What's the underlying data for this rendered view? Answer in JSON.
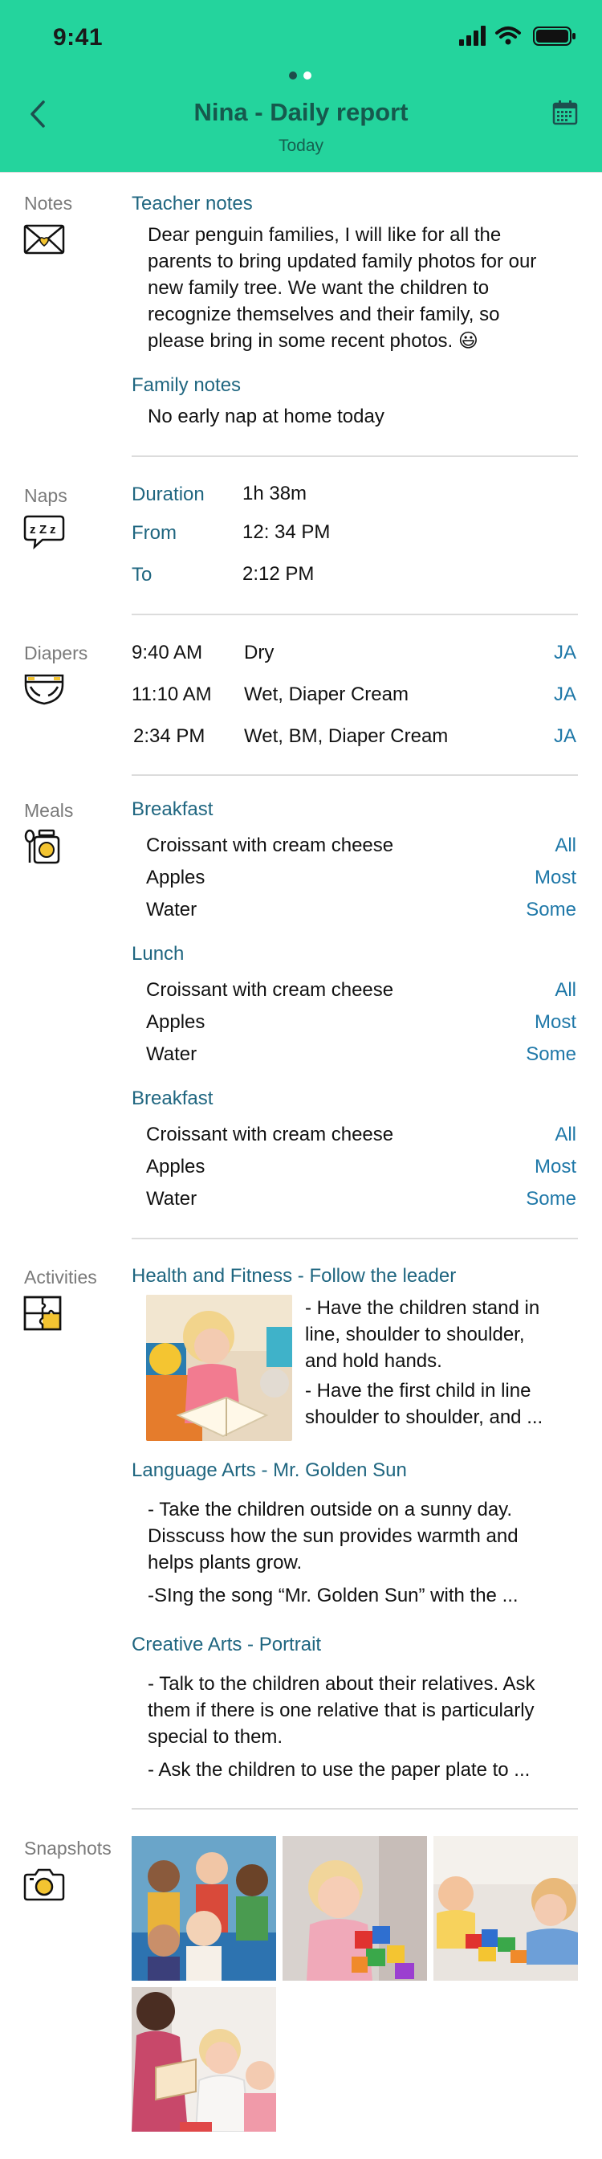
{
  "status": {
    "time": "9:41"
  },
  "nav": {
    "title": "Nina - Daily report",
    "subtitle": "Today"
  },
  "colors": {
    "header": "#24d49d",
    "accent": "#1f6680",
    "label": "#7a7a7a",
    "value_link": "#1f78a8"
  },
  "notes": {
    "label": "Notes",
    "icon": "envelope-heart-icon",
    "teacher_heading": "Teacher notes",
    "teacher_lines": [
      "Dear penguin families, I will like for all the",
      "parents to bring updated family photos for our",
      "new family tree. We want the children to",
      "recognize themselves and their family, so",
      "please bring in some recent photos."
    ],
    "emoji": "😃",
    "family_heading": "Family notes",
    "family_text": "No early nap at home today"
  },
  "naps": {
    "label": "Naps",
    "icon": "sleep-bubble-icon",
    "rows": [
      {
        "key": "Duration",
        "value": "1h 38m"
      },
      {
        "key": "From",
        "value": "12: 34 PM"
      },
      {
        "key": "To",
        "value": "2:12 PM"
      }
    ]
  },
  "diapers": {
    "label": "Diapers",
    "icon": "diaper-icon",
    "rows": [
      {
        "time": "9:40 AM",
        "type": "Dry",
        "by": "JA"
      },
      {
        "time": "11:10 AM",
        "type": "Wet, Diaper Cream",
        "by": "JA"
      },
      {
        "time": "2:34 PM",
        "type": "Wet, BM, Diaper Cream",
        "by": "JA"
      }
    ]
  },
  "meals": {
    "label": "Meals",
    "icon": "spoon-jar-icon",
    "groups": [
      {
        "name": "Breakfast",
        "items": [
          {
            "food": "Croissant with cream cheese",
            "amount": "All"
          },
          {
            "food": "Apples",
            "amount": "Most"
          },
          {
            "food": "Water",
            "amount": "Some"
          }
        ]
      },
      {
        "name": "Lunch",
        "items": [
          {
            "food": "Croissant with cream cheese",
            "amount": "All"
          },
          {
            "food": "Apples",
            "amount": "Most"
          },
          {
            "food": "Water",
            "amount": "Some"
          }
        ]
      },
      {
        "name": "Breakfast",
        "items": [
          {
            "food": "Croissant with cream cheese",
            "amount": "All"
          },
          {
            "food": "Apples",
            "amount": "Most"
          },
          {
            "food": "Water",
            "amount": "Some"
          }
        ]
      }
    ]
  },
  "activities": {
    "label": "Activities",
    "icon": "puzzle-icon",
    "items": [
      {
        "title": "Health and Fitness - Follow the leader",
        "lines": [
          "- Have the children stand in",
          "line, shoulder to shoulder,",
          "and hold hands.",
          "- Have the first child in line",
          "shoulder to shoulder, and ..."
        ]
      },
      {
        "title": "Language Arts - Mr. Golden Sun",
        "lines": [
          "- Take the children outside on a sunny day.",
          "Disscuss how the sun provides warmth and",
          "helps plants grow.",
          "-SIng the song “Mr. Golden Sun” with the ..."
        ]
      },
      {
        "title": "Creative Arts - Portrait",
        "lines": [
          "- Talk to the children about their relatives. Ask",
          "them if there is one relative that is particularly",
          "special to them.",
          "- Ask the children to use the paper plate to ..."
        ]
      }
    ]
  },
  "snapshots": {
    "label": "Snapshots",
    "icon": "camera-icon"
  }
}
